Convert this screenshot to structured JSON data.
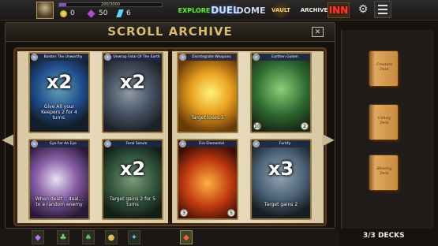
{
  "topbar": {
    "xp_text": "200/3000",
    "xp_fraction": 0.07,
    "coins": "0",
    "gems": "50",
    "crystals": "6",
    "tabs": {
      "explore": "EXPLORE",
      "duel": "DUEL",
      "dome": "DOME",
      "vault": "VAULT",
      "archive": "ARCHIVE",
      "inn": "INN"
    }
  },
  "panel": {
    "title": "SCROLL ARCHIVE",
    "close_label": "✕"
  },
  "cards": [
    {
      "name": "Bolster The Unworthy",
      "text": "Give All your Keepers 2 for 4 turns.",
      "mult": "x2",
      "left_stat": "",
      "right_stat": ""
    },
    {
      "name": "Unwrap Fatal Of The Earth",
      "text": "",
      "mult": "x2",
      "left_stat": "",
      "right_stat": ""
    },
    {
      "name": "Disintegrate Weapons",
      "text": "Target loses 3",
      "mult": "",
      "left_stat": "",
      "right_stat": ""
    },
    {
      "name": "Earthen Golem",
      "text": "",
      "mult": "",
      "left_stat": "10",
      "right_stat": "2"
    },
    {
      "name": "Eye For An Eye",
      "text": "When dealt... deal... to a random enemy",
      "mult": "",
      "left_stat": "",
      "right_stat": ""
    },
    {
      "name": "Feral Serum",
      "text": "Target gains 2 for 5 turns",
      "mult": "x2",
      "left_stat": "",
      "right_stat": ""
    },
    {
      "name": "Fire Elemental",
      "text": "",
      "mult": "",
      "left_stat": "3",
      "right_stat": "5"
    },
    {
      "name": "Fortify",
      "text": "Target gains 2",
      "mult": "x3",
      "left_stat": "",
      "right_stat": ""
    }
  ],
  "decks": {
    "items": [
      "Creature Deck",
      "Unholy Deck",
      "Blessing Deck"
    ],
    "count": "3/3 DECKS"
  },
  "colors": {
    "title": "#d9bd6d",
    "explore": "#6be04a",
    "inn": "#ff3a2a"
  }
}
